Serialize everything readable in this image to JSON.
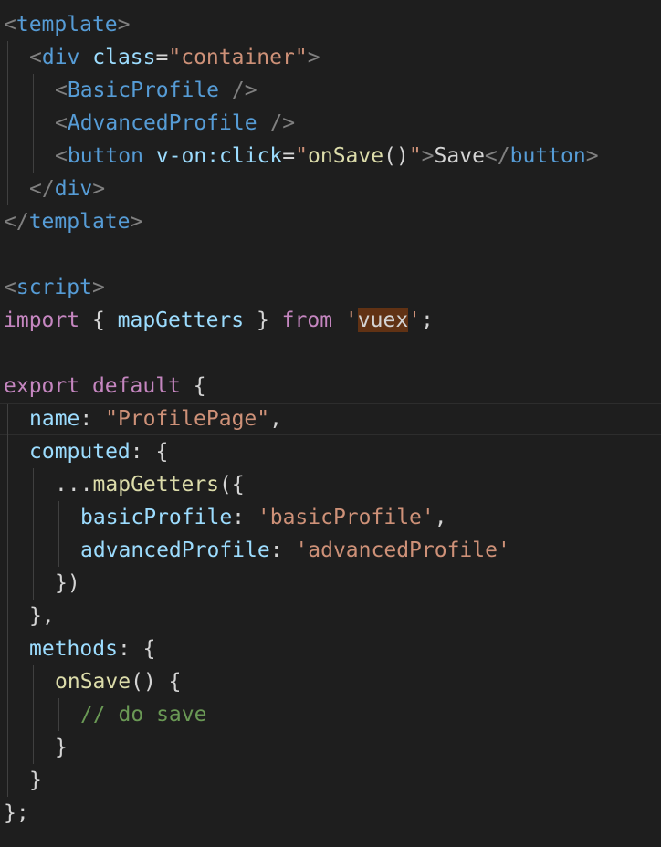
{
  "editor": {
    "language": "vue",
    "theme_colors": {
      "background": "#1e1e1e",
      "punctuation": "#808080",
      "tag": "#569cd6",
      "attribute": "#9cdcfe",
      "string": "#ce9178",
      "keyword": "#c586c0",
      "function": "#dcdcaa",
      "comment": "#6a9955",
      "selection_highlight": "#613214"
    },
    "lines": [
      {
        "indent": 0,
        "guides": 0,
        "tokens": [
          [
            "punc",
            "<"
          ],
          [
            "tag",
            "template"
          ],
          [
            "punc",
            ">"
          ]
        ]
      },
      {
        "indent": 1,
        "guides": 1,
        "tokens": [
          [
            "punc",
            "<"
          ],
          [
            "tag",
            "div"
          ],
          [
            "text",
            " "
          ],
          [
            "attr",
            "class"
          ],
          [
            "text",
            "="
          ],
          [
            "str",
            "\"container\""
          ],
          [
            "punc",
            ">"
          ]
        ]
      },
      {
        "indent": 2,
        "guides": 2,
        "tokens": [
          [
            "punc",
            "<"
          ],
          [
            "tag",
            "BasicProfile"
          ],
          [
            "text",
            " "
          ],
          [
            "punc",
            "/>"
          ]
        ]
      },
      {
        "indent": 2,
        "guides": 2,
        "tokens": [
          [
            "punc",
            "<"
          ],
          [
            "tag",
            "AdvancedProfile"
          ],
          [
            "text",
            " "
          ],
          [
            "punc",
            "/>"
          ]
        ]
      },
      {
        "indent": 2,
        "guides": 2,
        "tokens": [
          [
            "punc",
            "<"
          ],
          [
            "tag",
            "button"
          ],
          [
            "text",
            " "
          ],
          [
            "attr",
            "v-on:click"
          ],
          [
            "text",
            "="
          ],
          [
            "str",
            "\""
          ],
          [
            "fn",
            "onSave"
          ],
          [
            "text",
            "()"
          ],
          [
            "str",
            "\""
          ],
          [
            "punc",
            ">"
          ],
          [
            "text",
            "Save"
          ],
          [
            "punc",
            "</"
          ],
          [
            "tag",
            "button"
          ],
          [
            "punc",
            ">"
          ]
        ]
      },
      {
        "indent": 1,
        "guides": 1,
        "tokens": [
          [
            "punc",
            "</"
          ],
          [
            "tag",
            "div"
          ],
          [
            "punc",
            ">"
          ]
        ]
      },
      {
        "indent": 0,
        "guides": 0,
        "tokens": [
          [
            "punc",
            "</"
          ],
          [
            "tag",
            "template"
          ],
          [
            "punc",
            ">"
          ]
        ]
      },
      {
        "indent": 0,
        "guides": 0,
        "tokens": []
      },
      {
        "indent": 0,
        "guides": 0,
        "tokens": [
          [
            "punc",
            "<"
          ],
          [
            "tag",
            "script"
          ],
          [
            "punc",
            ">"
          ]
        ]
      },
      {
        "indent": 0,
        "guides": 0,
        "tokens": [
          [
            "kw",
            "import"
          ],
          [
            "text",
            " { "
          ],
          [
            "id",
            "mapGetters"
          ],
          [
            "text",
            " } "
          ],
          [
            "kw",
            "from"
          ],
          [
            "text",
            " "
          ],
          [
            "str",
            "'"
          ],
          [
            "hl",
            "vuex"
          ],
          [
            "str",
            "'"
          ],
          [
            "text",
            ";"
          ]
        ]
      },
      {
        "indent": 0,
        "guides": 0,
        "tokens": []
      },
      {
        "indent": 0,
        "guides": 0,
        "tokens": [
          [
            "kw",
            "export"
          ],
          [
            "text",
            " "
          ],
          [
            "kw",
            "default"
          ],
          [
            "text",
            " {"
          ]
        ]
      },
      {
        "indent": 1,
        "guides": 1,
        "current": true,
        "tokens": [
          [
            "id",
            "name"
          ],
          [
            "text",
            ": "
          ],
          [
            "str",
            "\"ProfilePage\""
          ],
          [
            "text",
            ","
          ]
        ]
      },
      {
        "indent": 1,
        "guides": 1,
        "tokens": [
          [
            "id",
            "computed"
          ],
          [
            "text",
            ": {"
          ]
        ]
      },
      {
        "indent": 2,
        "guides": 2,
        "tokens": [
          [
            "text",
            "..."
          ],
          [
            "fn",
            "mapGetters"
          ],
          [
            "text",
            "({"
          ]
        ]
      },
      {
        "indent": 3,
        "guides": 3,
        "tokens": [
          [
            "id",
            "basicProfile"
          ],
          [
            "text",
            ": "
          ],
          [
            "str",
            "'basicProfile'"
          ],
          [
            "text",
            ","
          ]
        ]
      },
      {
        "indent": 3,
        "guides": 3,
        "tokens": [
          [
            "id",
            "advancedProfile"
          ],
          [
            "text",
            ": "
          ],
          [
            "str",
            "'advancedProfile'"
          ]
        ]
      },
      {
        "indent": 2,
        "guides": 2,
        "tokens": [
          [
            "text",
            "})"
          ]
        ]
      },
      {
        "indent": 1,
        "guides": 1,
        "tokens": [
          [
            "text",
            "},"
          ]
        ]
      },
      {
        "indent": 1,
        "guides": 1,
        "tokens": [
          [
            "id",
            "methods"
          ],
          [
            "text",
            ": {"
          ]
        ]
      },
      {
        "indent": 2,
        "guides": 2,
        "tokens": [
          [
            "fn",
            "onSave"
          ],
          [
            "text",
            "() {"
          ]
        ]
      },
      {
        "indent": 3,
        "guides": 3,
        "tokens": [
          [
            "cmt",
            "// do save"
          ]
        ]
      },
      {
        "indent": 2,
        "guides": 2,
        "tokens": [
          [
            "text",
            "}"
          ]
        ]
      },
      {
        "indent": 1,
        "guides": 1,
        "tokens": [
          [
            "text",
            "}"
          ]
        ]
      },
      {
        "indent": 0,
        "guides": 0,
        "tokens": [
          [
            "text",
            "};"
          ]
        ]
      }
    ]
  }
}
